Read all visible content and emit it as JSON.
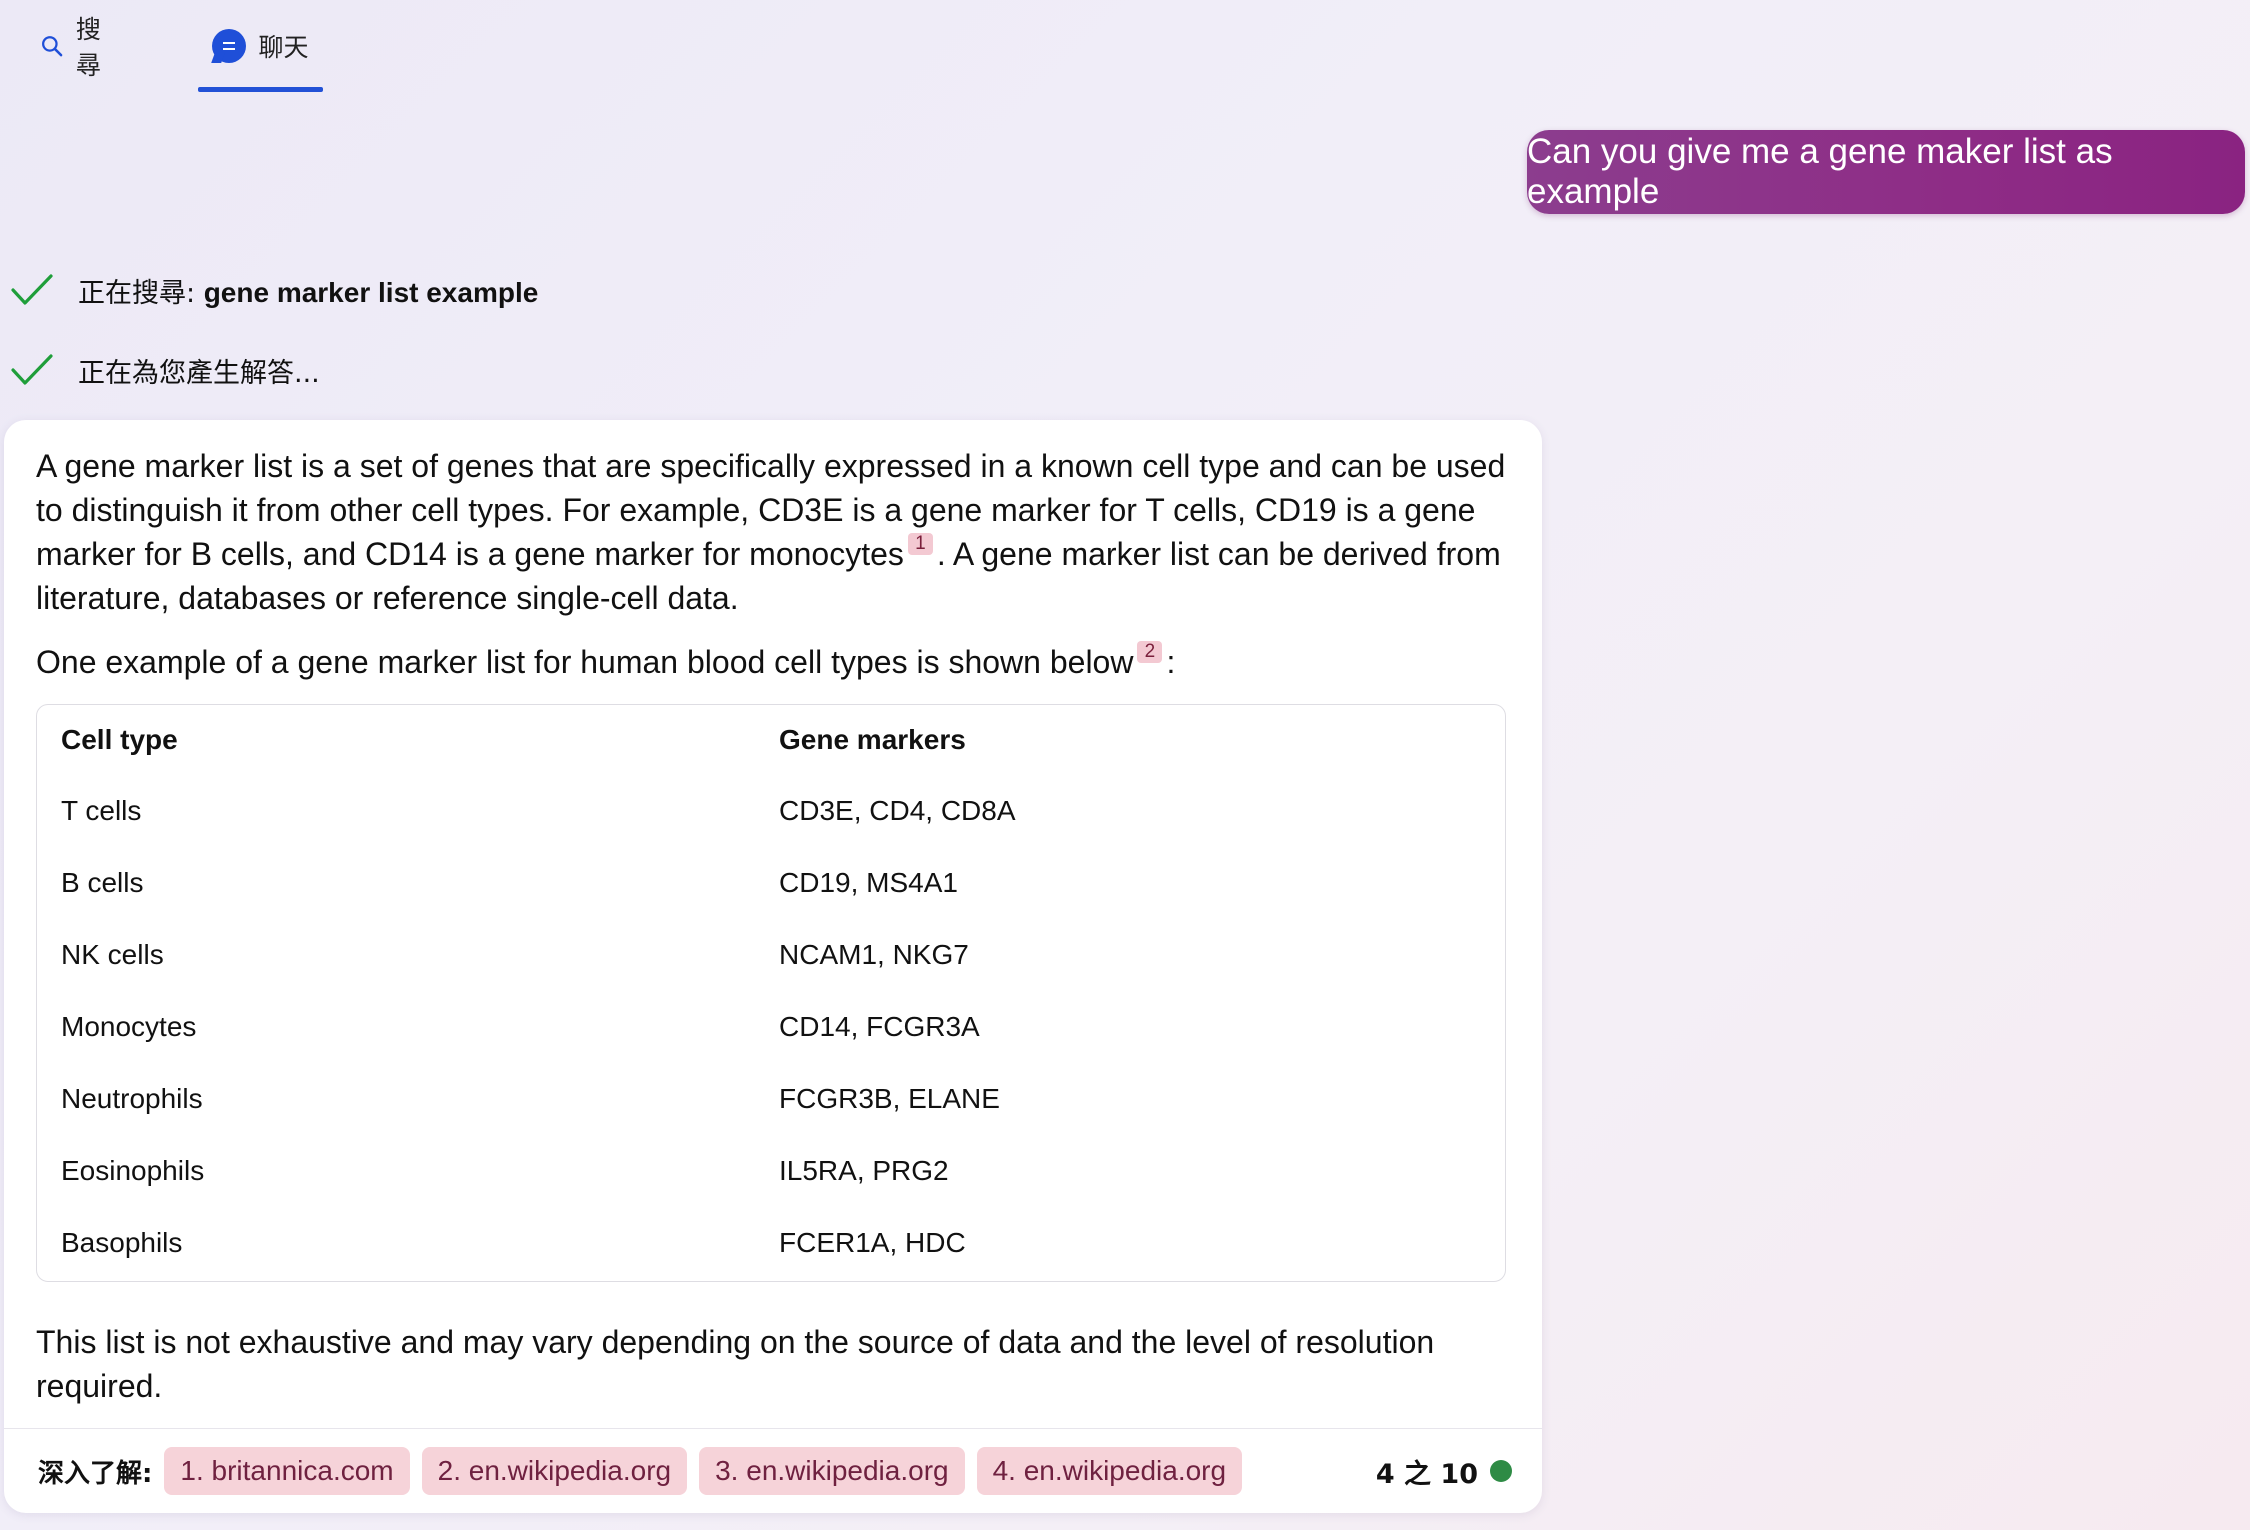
{
  "tabs": {
    "search_label": "搜尋",
    "chat_label": "聊天"
  },
  "user_message": "Can you give me a gene maker list as example",
  "status": {
    "searching_prefix": "正在搜尋: ",
    "searching_query": "gene marker list example",
    "generating": "正在為您產生解答..."
  },
  "answer": {
    "para1_text1": "A gene marker list is a set of genes that are specifically expressed in a known cell type and can be used to distinguish it from other cell types. For example, CD3E is a gene marker for T cells, CD19 is a gene marker for B cells, and CD14 is a gene marker for monocytes",
    "para1_cite": "1",
    "para1_text2": ". A gene marker list can be derived from literature, databases or reference single-cell data.",
    "para2_text1": "One example of a gene marker list for human blood cell types is shown below",
    "para2_cite": "2",
    "para2_text2": ":",
    "table": {
      "headers": [
        "Cell type",
        "Gene markers"
      ],
      "rows": [
        [
          "T cells",
          "CD3E, CD4, CD8A"
        ],
        [
          "B cells",
          "CD19, MS4A1"
        ],
        [
          "NK cells",
          "NCAM1, NKG7"
        ],
        [
          "Monocytes",
          "CD14, FCGR3A"
        ],
        [
          "Neutrophils",
          "FCGR3B, ELANE"
        ],
        [
          "Eosinophils",
          "IL5RA, PRG2"
        ],
        [
          "Basophils",
          "FCER1A, HDC"
        ]
      ]
    },
    "para3": "This list is not exhaustive and may vary depending on the source of data and the level of resolution required."
  },
  "footer": {
    "learn_more_label": "深入了解:",
    "sources": [
      "1. britannica.com",
      "2. en.wikipedia.org",
      "3. en.wikipedia.org",
      "4. en.wikipedia.org"
    ],
    "counter": "4 之 10"
  },
  "colors": {
    "accent_blue": "#1f4fd8",
    "user_bubble": "#8e2c86",
    "check_green": "#1f9e3a",
    "counter_dot": "#2e8b45",
    "cite_bg": "#f3c9d2"
  },
  "icons": [
    "search-icon",
    "chat-icon",
    "check-icon"
  ]
}
